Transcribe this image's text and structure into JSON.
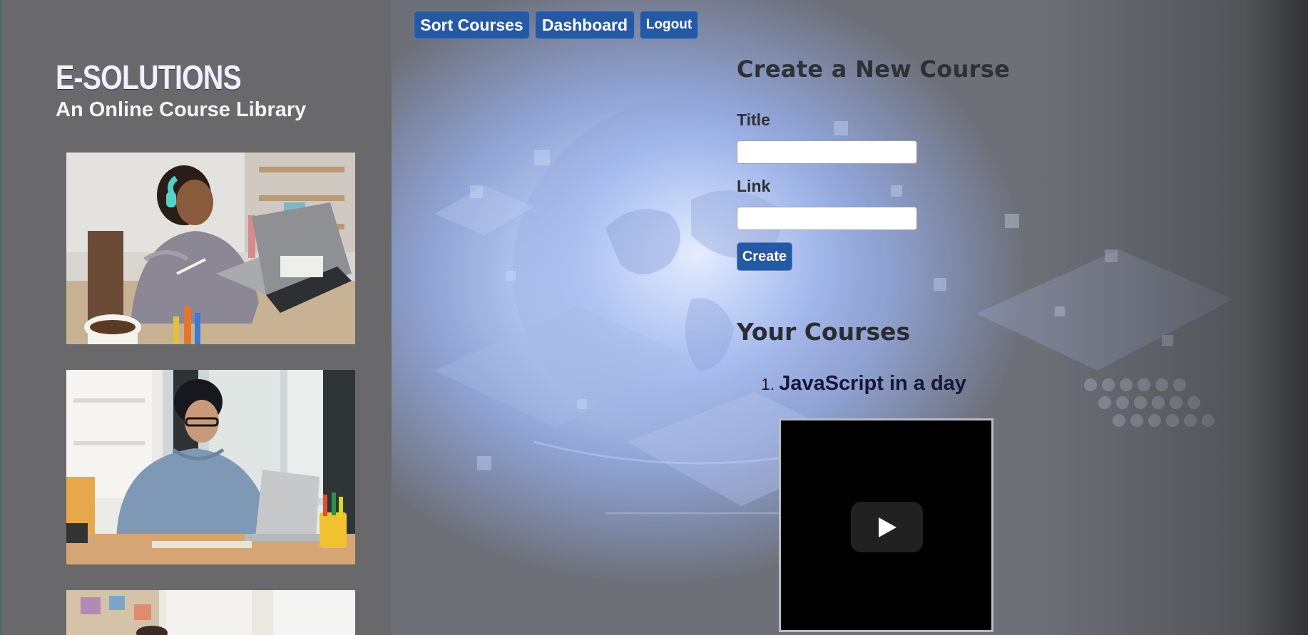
{
  "brand": {
    "title": "E-SOLUTIONS",
    "subtitle": "An Online Course Library"
  },
  "nav": {
    "sort_label": "Sort Courses",
    "dashboard_label": "Dashboard",
    "logout_label": "Logout"
  },
  "create_form": {
    "heading": "Create a New Course",
    "title_label": "Title",
    "title_value": "",
    "link_label": "Link",
    "link_value": "",
    "create_label": "Create"
  },
  "courses": {
    "heading": "Your Courses",
    "items": [
      {
        "number": "1.",
        "title": "JavaScript in a day"
      }
    ]
  },
  "video": {
    "play_icon": "play-icon"
  },
  "colors": {
    "button_blue": "#2559a4",
    "sidebar_gray": "#69696c",
    "heading_dark": "#2f3136"
  }
}
